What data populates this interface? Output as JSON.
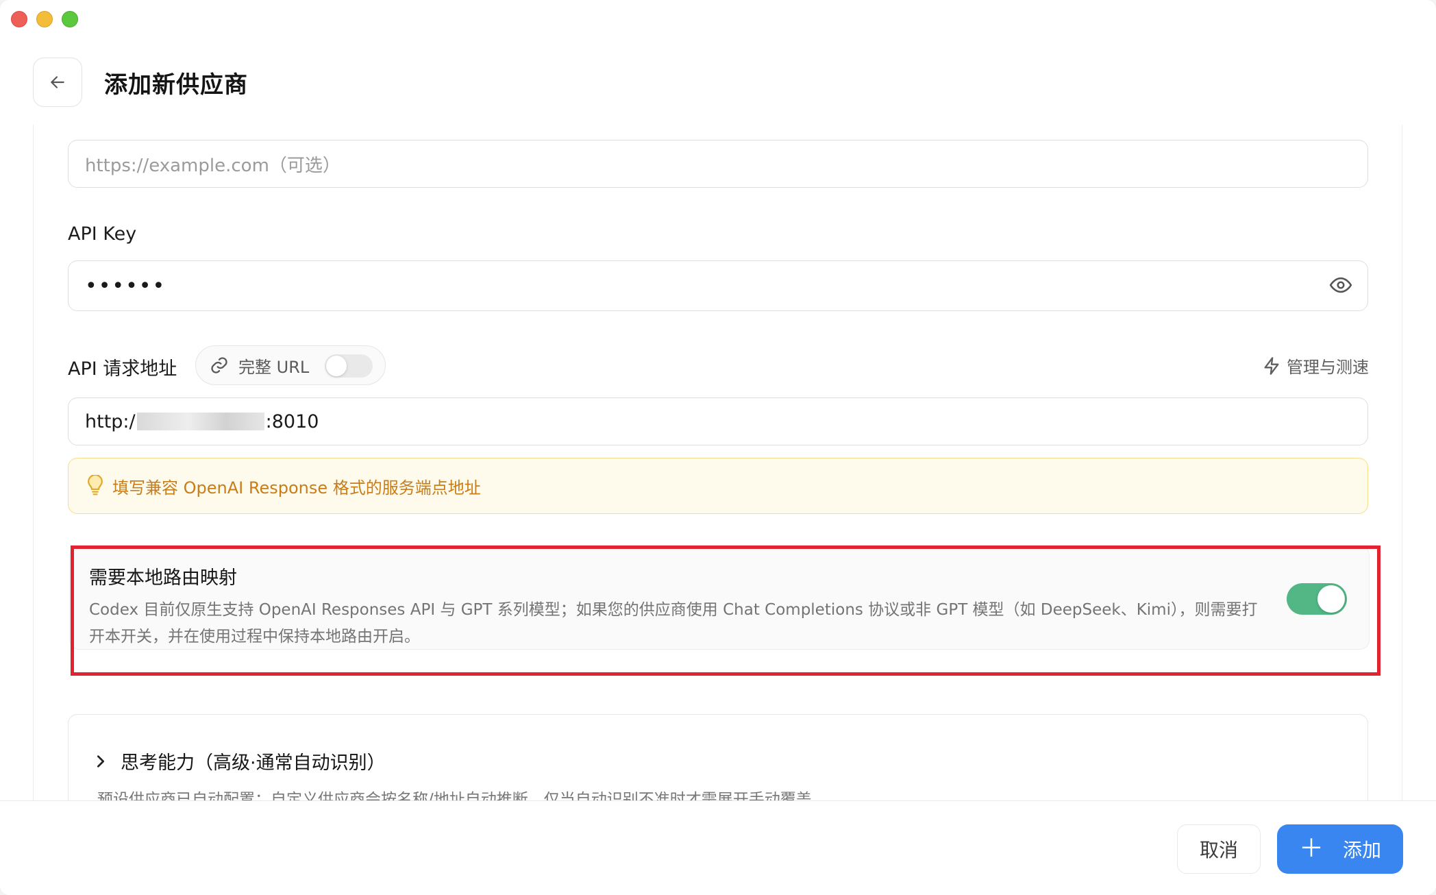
{
  "window": {
    "title": "添加新供应商"
  },
  "form": {
    "website": {
      "placeholder": "https://example.com（可选）"
    },
    "api_key": {
      "label": "API Key",
      "value": "••••••",
      "toggle_icon": "eye-icon"
    },
    "api_url": {
      "label": "API 请求地址",
      "full_url_toggle_label": "完整 URL",
      "full_url_toggle_on": false,
      "manage_link": "管理与测速",
      "value_prefix": "http:/",
      "value_suffix": ":8010",
      "tip": "填写兼容 OpenAI Response 格式的服务端点地址"
    },
    "local_route": {
      "title": "需要本地路由映射",
      "description": "Codex 目前仅原生支持 OpenAI Responses API 与 GPT 系列模型；如果您的供应商使用 Chat Completions 协议或非 GPT 模型（如 DeepSeek、Kimi），则需要打开本开关，并在使用过程中保持本地路由开启。",
      "enabled": true
    },
    "thinking": {
      "title": "思考能力（高级·通常自动识别）",
      "subtitle": "预设供应商已自动配置；自定义供应商会按名称/地址自动推断，仅当自动识别不准时才需展开手动覆盖。"
    }
  },
  "footer": {
    "cancel_label": "取消",
    "add_label": "添加",
    "add_icon": "＋"
  },
  "colors": {
    "accent": "#3a86f0",
    "toggle_on": "#52b785",
    "tip_text": "#c97d18",
    "highlight": "#e0232e"
  }
}
